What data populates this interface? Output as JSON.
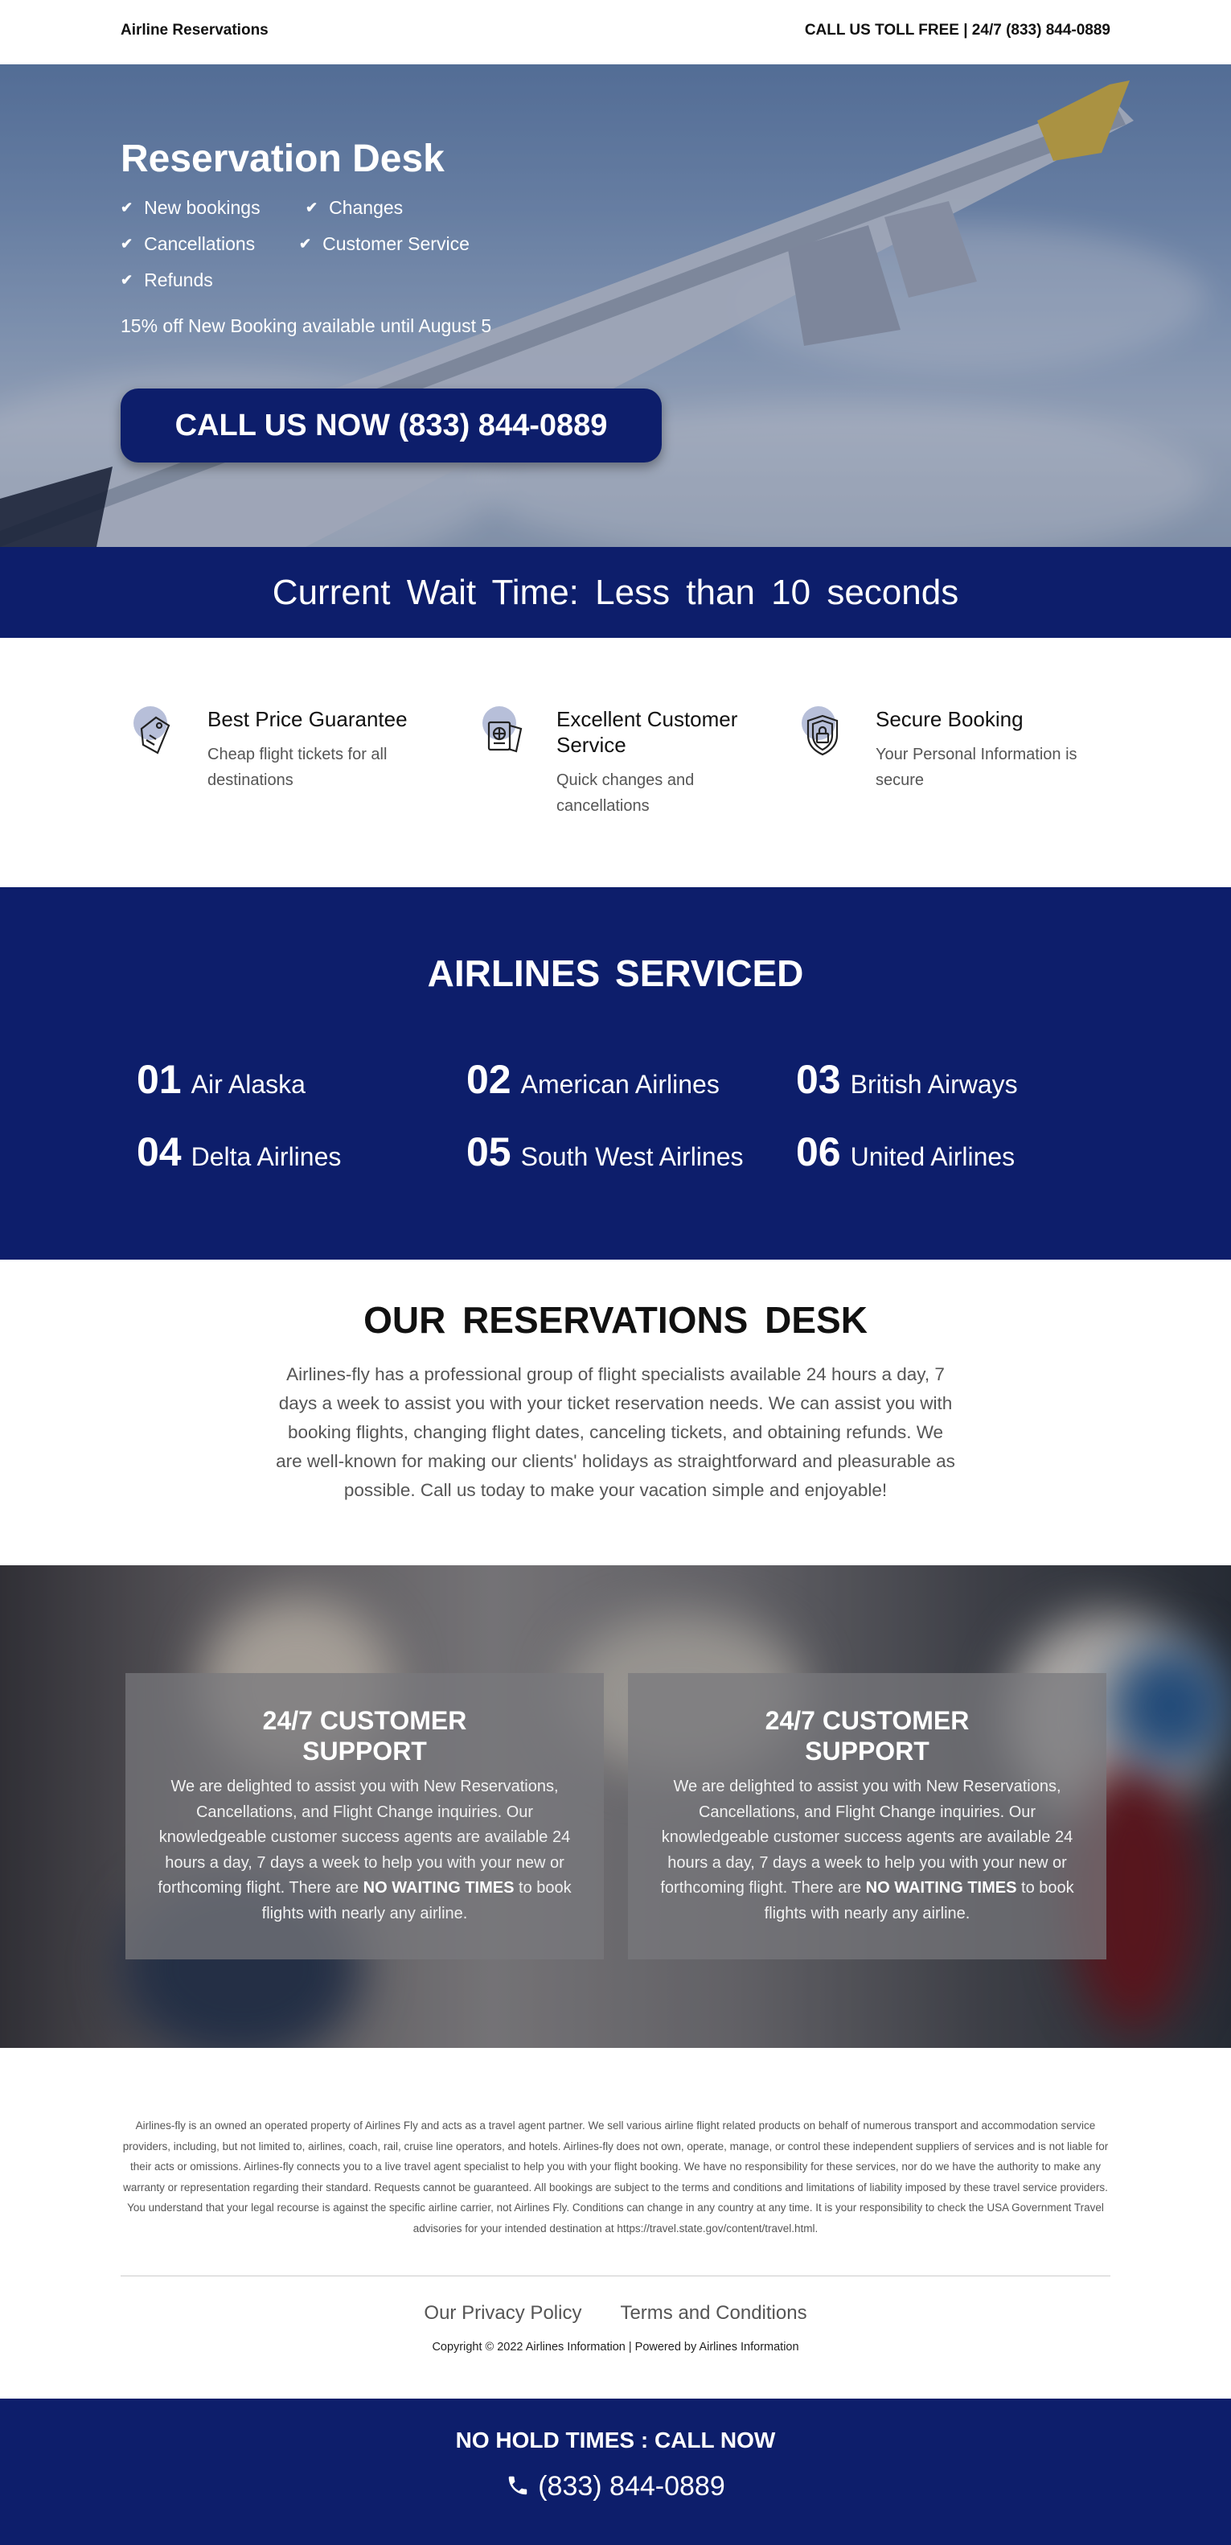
{
  "header": {
    "brand": "Airline Reservations",
    "tollfree": "CALL US TOLL FREE | 24/7 (833) 844-0889"
  },
  "hero": {
    "title": "Reservation Desk",
    "features": [
      "New bookings",
      "Changes",
      "Cancellations",
      "Customer Service",
      "Refunds"
    ],
    "offer": "15% off New Booking available until August 5",
    "cta": "CALL US NOW (833) 844-0889"
  },
  "wait": {
    "text": "Current Wait Time: Less than 10 seconds"
  },
  "features": [
    {
      "icon": "price-tag-icon",
      "title": "Best Price Guarantee",
      "desc_line1": "Cheap flight tickets for all",
      "desc_line2": "destinations"
    },
    {
      "icon": "passport-icon",
      "title_line1": "Excellent Customer",
      "title_line2": "Service",
      "desc_line1": "Quick changes and",
      "desc_line2": "cancellations"
    },
    {
      "icon": "shield-lock-icon",
      "title": "Secure Booking",
      "desc_line1": "Your Personal Information is",
      "desc_line2": "secure"
    }
  ],
  "airlines": {
    "heading": "AIRLINES SERVICED",
    "items": [
      {
        "num": "01",
        "name": "Air Alaska"
      },
      {
        "num": "02",
        "name": "American Airlines"
      },
      {
        "num": "03",
        "name": "British Airways"
      },
      {
        "num": "04",
        "name": "Delta Airlines"
      },
      {
        "num": "05",
        "name": "South West Airlines"
      },
      {
        "num": "06",
        "name": "United Airlines"
      }
    ]
  },
  "desk": {
    "heading": "OUR RESERVATIONS DESK",
    "body": "Airlines-fly has a professional group of flight specialists available 24 hours a day, 7 days a week to assist you with your ticket reservation needs. We can assist you with booking flights, changing flight dates, canceling tickets, and obtaining refunds. We are well-known for making our clients' holidays as straightforward and pleasurable as possible. Call us today to make your vacation simple and enjoyable!"
  },
  "support": {
    "title_line1": "24/7 CUSTOMER",
    "title_line2": "SUPPORT",
    "body_start": "We are delighted to assist you with New Reservations, Cancellations, and Flight Change inquiries. Our knowledgeable customer success agents are available 24 hours a day, 7 days a week to help you with your new or forthcoming flight. There are ",
    "body_bold": "NO WAITING TIMES",
    "body_end": " to book flights with nearly any airline."
  },
  "footer": {
    "disclaimer": "Airlines-fly is an owned an operated property of Airlines Fly and acts as a travel agent partner. We sell various airline flight related products on behalf of numerous transport and accommodation service providers, including, but not limited to, airlines, coach, rail, cruise line operators, and hotels. Airlines-fly does not own, operate, manage, or control these independent suppliers of services and is not liable for their acts or omissions. Airlines-fly connects you to a live travel agent specialist to help you with your flight booking. We have no responsibility for these services, nor do we have the authority to make any warranty or representation regarding their standard. Requests cannot be guaranteed. All bookings are subject to the terms and conditions and limitations of liability imposed by these travel service providers. You understand that your legal recourse is against the specific airline carrier, not Airlines Fly. Conditions can change in any country at any time. It is your responsibility to check the USA Government Travel advisories for your intended destination at https://travel.state.gov/content/travel.html.",
    "privacy": "Our Privacy Policy",
    "terms": "Terms and Conditions",
    "copyright": "Copyright © 2022 Airlines Information | Powered by Airlines Information"
  },
  "bottom": {
    "line1": "NO HOLD TIMES : CALL NOW",
    "phone": "(833) 844-0889"
  },
  "colors": {
    "navy": "#0d1e6b",
    "icon_blob": "#b7bfd9"
  }
}
